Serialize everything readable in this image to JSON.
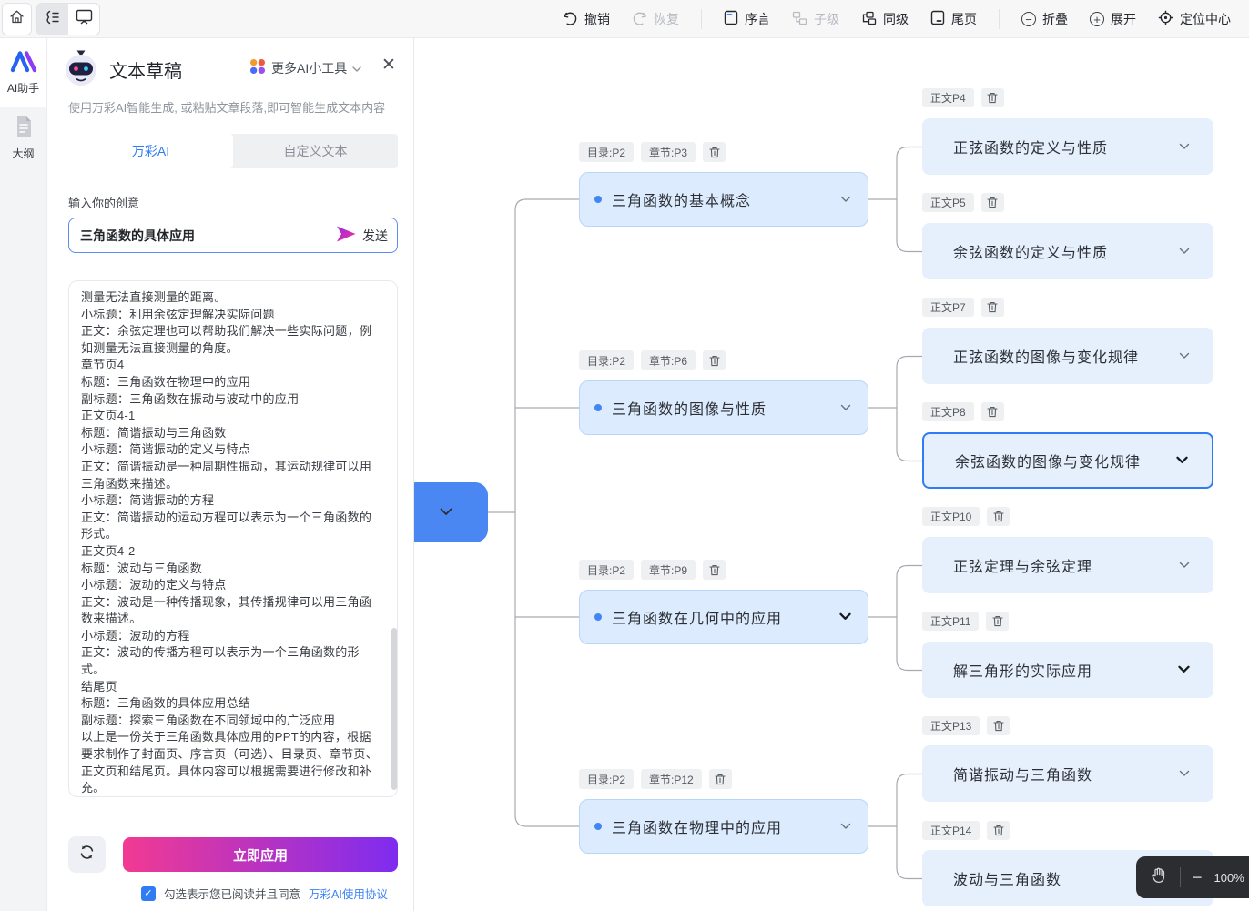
{
  "toolbar": {
    "undo": "撤销",
    "redo": "恢复",
    "preface": "序言",
    "child": "子级",
    "sibling": "同级",
    "tail": "尾页",
    "collapse": "折叠",
    "expand": "展开",
    "center": "定位中心"
  },
  "rail": {
    "ai": "AI助手",
    "outline": "大纲"
  },
  "panel": {
    "title": "文本草稿",
    "more_tools": "更多AI小工具",
    "subtitle": "使用万彩AI智能生成, 或粘贴文章段落,即可智能生成文本内容",
    "tabs": [
      {
        "label": "万彩AI"
      },
      {
        "label": "自定义文本"
      }
    ],
    "input_label": "输入你的创意",
    "input_value": "三角函数的具体应用",
    "send_label": "发送",
    "draft_lines": [
      "测量无法直接测量的距离。",
      "小标题：利用余弦定理解决实际问题",
      "正文：余弦定理也可以帮助我们解决一些实际问题，例如测量无法直接测量的角度。",
      "章节页4",
      "标题：三角函数在物理中的应用",
      "副标题：三角函数在振动与波动中的应用",
      "正文页4-1",
      "标题：简谐振动与三角函数",
      "小标题：简谐振动的定义与特点",
      "正文：简谐振动是一种周期性振动，其运动规律可以用三角函数来描述。",
      "小标题：简谐振动的方程",
      "正文：简谐振动的运动方程可以表示为一个三角函数的形式。",
      "正文页4-2",
      "标题：波动与三角函数",
      "小标题：波动的定义与特点",
      "正文：波动是一种传播现象，其传播规律可以用三角函数来描述。",
      "小标题：波动的方程",
      "正文：波动的传播方程可以表示为一个三角函数的形式。",
      "结尾页",
      "标题：三角函数的具体应用总结",
      "副标题：探索三角函数在不同领域中的广泛应用",
      "以上是一份关于三角函数具体应用的PPT的内容，根据要求制作了封面页、序言页（可选）、目录页、章节页、正文页和结尾页。具体内容可以根据需要进行修改和补充。"
    ],
    "apply_label": "立即应用",
    "agreement_text": "勾选表示您已阅读并且同意",
    "agreement_link": "万彩AI使用协议"
  },
  "mindmap": {
    "branches": [
      {
        "badges": [
          "目录:P2",
          "章节:P3"
        ],
        "label": "三角函数的基本概念",
        "children": [
          {
            "badge": "正文P4",
            "label": "正弦函数的定义与性质"
          },
          {
            "badge": "正文P5",
            "label": "余弦函数的定义与性质"
          }
        ]
      },
      {
        "badges": [
          "目录:P2",
          "章节:P6"
        ],
        "label": "三角函数的图像与性质",
        "children": [
          {
            "badge": "正文P7",
            "label": "正弦函数的图像与变化规律"
          },
          {
            "badge": "正文P8",
            "label": "余弦函数的图像与变化规律",
            "selected": true
          }
        ]
      },
      {
        "badges": [
          "目录:P2",
          "章节:P9"
        ],
        "label": "三角函数在几何中的应用",
        "children": [
          {
            "badge": "正文P10",
            "label": "正弦定理与余弦定理"
          },
          {
            "badge": "正文P11",
            "label": "解三角形的实际应用"
          }
        ]
      },
      {
        "badges": [
          "目录:P2",
          "章节:P12"
        ],
        "label": "三角函数在物理中的应用",
        "children": [
          {
            "badge": "正文P13",
            "label": "简谐振动与三角函数"
          },
          {
            "badge": "正文P14",
            "label": "波动与三角函数"
          }
        ]
      }
    ]
  },
  "zoom_control": {
    "level": "100%"
  },
  "colors": {
    "accent": "#2f7cf5",
    "root_fill": "#4b87f2",
    "main_node_fill": "#dcebfd",
    "child_node_fill": "#e6effc",
    "selected_border": "#2f7cf5",
    "apply_gradient_start": "#f23a92",
    "apply_gradient_end": "#7e2cf0",
    "link": "#3b82f6"
  }
}
